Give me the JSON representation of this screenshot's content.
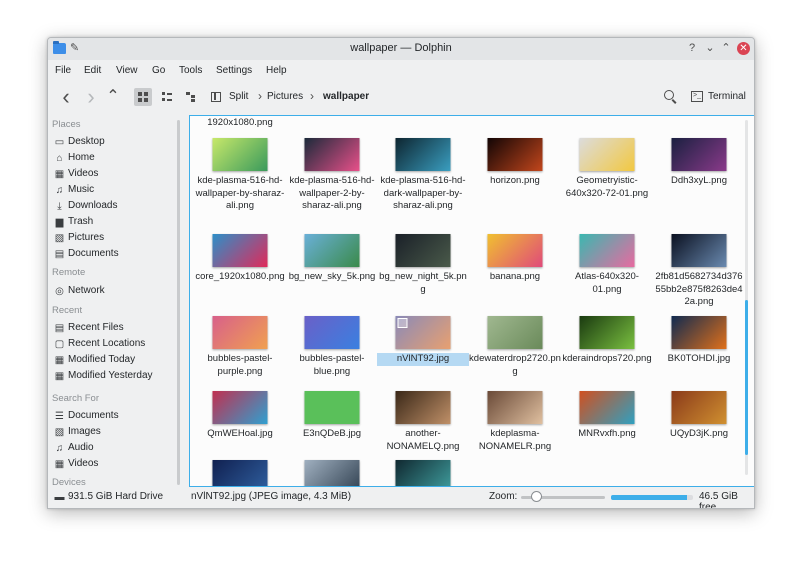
{
  "window": {
    "title": "wallpaper — Dolphin",
    "help_glyph": "?",
    "minimize_glyph": "⌄",
    "maximize_glyph": "⌃",
    "close_glyph": "✕"
  },
  "menubar": [
    "File",
    "Edit",
    "View",
    "Go",
    "Tools",
    "Settings",
    "Help"
  ],
  "toolbar": {
    "back_glyph": "‹",
    "forward_glyph": "›",
    "up_glyph": "⌃",
    "split_label": "Split",
    "breadcrumb": [
      "Pictures",
      "wallpaper"
    ],
    "breadcrumb_sep": "›",
    "terminal_label": "Terminal",
    "terminal_glyph": ">_"
  },
  "sidebar": {
    "sections": [
      {
        "title": "Places",
        "items": [
          {
            "label": "Desktop",
            "icon": "desktop-icon",
            "glyph": "▭"
          },
          {
            "label": "Home",
            "icon": "home-icon",
            "glyph": "⌂"
          },
          {
            "label": "Videos",
            "icon": "videos-icon",
            "glyph": "▦"
          },
          {
            "label": "Music",
            "icon": "music-icon",
            "glyph": "♫"
          },
          {
            "label": "Downloads",
            "icon": "downloads-icon",
            "glyph": "⤓"
          },
          {
            "label": "Trash",
            "icon": "trash-icon",
            "glyph": "▆"
          },
          {
            "label": "Pictures",
            "icon": "pictures-icon",
            "glyph": "▧"
          },
          {
            "label": "Documents",
            "icon": "documents-icon",
            "glyph": "▤"
          }
        ]
      },
      {
        "title": "Remote",
        "items": [
          {
            "label": "Network",
            "icon": "network-icon",
            "glyph": "◎"
          }
        ]
      },
      {
        "title": "Recent",
        "items": [
          {
            "label": "Recent Files",
            "icon": "recent-files-icon",
            "glyph": "▤"
          },
          {
            "label": "Recent Locations",
            "icon": "recent-locations-icon",
            "glyph": "▢"
          },
          {
            "label": "Modified Today",
            "icon": "calendar-icon",
            "glyph": "▦"
          },
          {
            "label": "Modified Yesterday",
            "icon": "calendar-icon",
            "glyph": "▦"
          }
        ]
      },
      {
        "title": "Search For",
        "items": [
          {
            "label": "Documents",
            "icon": "documents-icon",
            "glyph": "☰"
          },
          {
            "label": "Images",
            "icon": "images-icon",
            "glyph": "▧"
          },
          {
            "label": "Audio",
            "icon": "audio-icon",
            "glyph": "♫"
          },
          {
            "label": "Videos",
            "icon": "videos-icon",
            "glyph": "▦"
          }
        ]
      },
      {
        "title": "Devices",
        "items": [
          {
            "label": "931.5 GiB Hard Drive",
            "icon": "hard-drive-icon",
            "glyph": "▬"
          }
        ]
      }
    ]
  },
  "files": {
    "top_partial": [
      "1920x1080.png"
    ],
    "items": [
      {
        "name": "kde-plasma-516-hd-wallpaper-by-sharaz-ali.png",
        "colors": [
          "#c7e86a",
          "#3a9a5c"
        ]
      },
      {
        "name": "kde-plasma-516-hd-wallpaper-2-by-sharaz-ali.png",
        "colors": [
          "#1b2a3a",
          "#e8508a"
        ]
      },
      {
        "name": "kde-plasma-516-hd-dark-wallpaper-by-sharaz-ali.png",
        "colors": [
          "#0d2530",
          "#3a9ec0"
        ]
      },
      {
        "name": "horizon.png",
        "colors": [
          "#120505",
          "#c2461c"
        ]
      },
      {
        "name": "Geometryistic-640x320-72-01.png",
        "colors": [
          "#dcdcdc",
          "#f2c840"
        ]
      },
      {
        "name": "Ddh3xyL.png",
        "colors": [
          "#1a2040",
          "#8a3a8a"
        ]
      },
      {
        "name": "core_1920x1080.png",
        "colors": [
          "#2d8fc8",
          "#e02a5a"
        ]
      },
      {
        "name": "bg_new_sky_5k.png",
        "colors": [
          "#6ab0d8",
          "#3a8a4a"
        ]
      },
      {
        "name": "bg_new_night_5k.png",
        "colors": [
          "#1a2028",
          "#4a5a4a"
        ]
      },
      {
        "name": "banana.png",
        "colors": [
          "#f0c030",
          "#e04a7a"
        ]
      },
      {
        "name": "Atlas-640x320-01.png",
        "colors": [
          "#3ab8b0",
          "#e86aa0"
        ]
      },
      {
        "name": "2fb81d5682734d37655bb2e875f8263de42a.png",
        "colors": [
          "#0a1020",
          "#6a8ab0"
        ]
      },
      {
        "name": "bubbles-pastel-purple.png",
        "colors": [
          "#d8608a",
          "#f0a050"
        ]
      },
      {
        "name": "bubbles-pastel-blue.png",
        "colors": [
          "#6a60c8",
          "#3a80e0"
        ]
      },
      {
        "name": "nVlNT92.jpg",
        "colors": [
          "#8a8ab8",
          "#e8a070"
        ]
      },
      {
        "name": "kdewaterdrop2720.png",
        "colors": [
          "#a0b890",
          "#6a8a5a"
        ]
      },
      {
        "name": "kderaindrops720.png",
        "colors": [
          "#1a3a10",
          "#7ac040"
        ]
      },
      {
        "name": "BK0TOHDI.jpg",
        "colors": [
          "#102a50",
          "#e0701a"
        ]
      },
      {
        "name": "QmWEHoal.jpg",
        "colors": [
          "#c03050",
          "#30a0d0"
        ]
      },
      {
        "name": "E3nQDeB.jpg",
        "colors": [
          "#5ac05a",
          "#5ac05a"
        ]
      },
      {
        "name": "another-NONAMELQ.png",
        "colors": [
          "#3a2818",
          "#c09068"
        ]
      },
      {
        "name": "kdeplasma-NONAMELR.png",
        "colors": [
          "#6a4a38",
          "#e0c0a0"
        ]
      },
      {
        "name": "MNRvxfh.png",
        "colors": [
          "#d05020",
          "#30a0c0"
        ]
      },
      {
        "name": "UQyD3jK.png",
        "colors": [
          "#8a3a1a",
          "#d09030"
        ]
      },
      {
        "name": "",
        "colors": [
          "#102050",
          "#3060a0"
        ]
      },
      {
        "name": "",
        "colors": [
          "#a0b0c0",
          "#304050"
        ]
      },
      {
        "name": "",
        "colors": [
          "#102830",
          "#40a0a0"
        ]
      }
    ],
    "selected_index": 14
  },
  "statusbar": {
    "selection": "nVlNT92.jpg (JPEG image, 4.3 MiB)",
    "zoom_label": "Zoom:",
    "free_space": "46.5 GiB free",
    "free_fraction": 0.93
  }
}
